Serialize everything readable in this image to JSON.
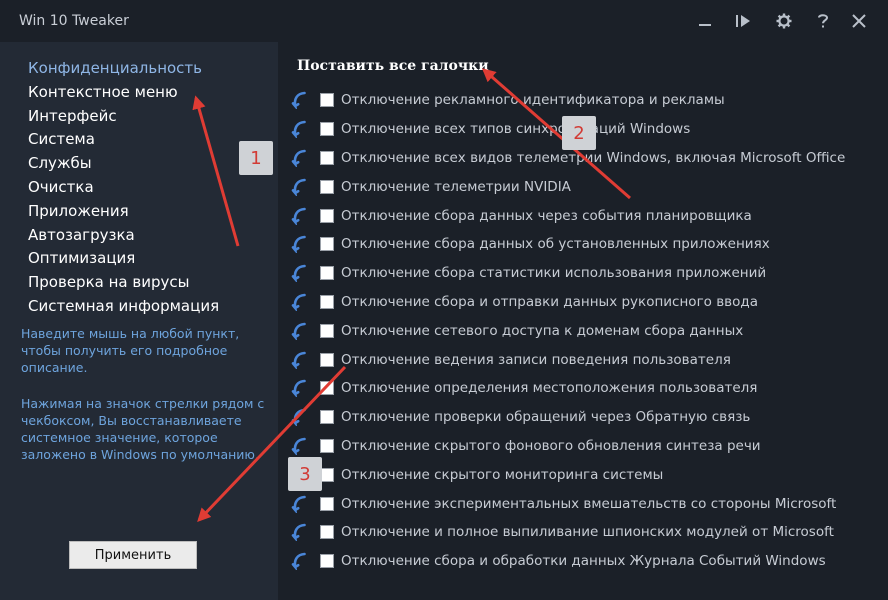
{
  "window": {
    "title": "Win 10 Tweaker"
  },
  "titlebar_controls": [
    {
      "name": "minimize-button",
      "icon": "minimize-icon"
    },
    {
      "name": "play-button",
      "icon": "play-icon"
    },
    {
      "name": "settings-button",
      "icon": "gear-icon"
    },
    {
      "name": "help-button",
      "icon": "question-icon"
    },
    {
      "name": "close-button",
      "icon": "close-icon"
    }
  ],
  "sidebar": {
    "items": [
      {
        "label": "Конфиденциальность",
        "active": true
      },
      {
        "label": "Контекстное меню",
        "active": false
      },
      {
        "label": "Интерфейс",
        "active": false
      },
      {
        "label": "Система",
        "active": false
      },
      {
        "label": "Службы",
        "active": false
      },
      {
        "label": "Очистка",
        "active": false
      },
      {
        "label": "Приложения",
        "active": false
      },
      {
        "label": "Автозагрузка",
        "active": false
      },
      {
        "label": "Оптимизация",
        "active": false
      },
      {
        "label": "Проверка на вирусы",
        "active": false
      },
      {
        "label": "Системная информация",
        "active": false
      }
    ],
    "hint1": "Наведите мышь на любой пункт, чтобы получить его подробное описание.",
    "hint2": "Нажимая на значок стрелки рядом с чекбоксом, Вы восстанавливаете системное значение, которое заложено в Windows по умолчанию.",
    "apply_label": "Применить"
  },
  "main": {
    "check_all_label": "Поставить все галочки",
    "options": [
      {
        "label": "Отключение рекламного идентификатора и рекламы",
        "checked": false
      },
      {
        "label": "Отключение всех типов синхронизаций Windows",
        "checked": false
      },
      {
        "label": "Отключение всех видов телеметрии Windows, включая Microsoft Office",
        "checked": false
      },
      {
        "label": "Отключение телеметрии NVIDIA",
        "checked": false
      },
      {
        "label": "Отключение сбора данных через события планировщика",
        "checked": false
      },
      {
        "label": "Отключение сбора данных об установленных приложениях",
        "checked": false
      },
      {
        "label": "Отключение сбора статистики использования приложений",
        "checked": false
      },
      {
        "label": "Отключение сбора и отправки данных рукописного ввода",
        "checked": false
      },
      {
        "label": "Отключение сетевого доступа к доменам сбора данных",
        "checked": false
      },
      {
        "label": "Отключение ведения записи поведения пользователя",
        "checked": false
      },
      {
        "label": "Отключение определения местоположения пользователя",
        "checked": false
      },
      {
        "label": "Отключение проверки обращений через Обратную связь",
        "checked": false
      },
      {
        "label": "Отключение скрытого фонового обновления синтеза речи",
        "checked": false
      },
      {
        "label": "Отключение скрытого мониторинга системы",
        "checked": false
      },
      {
        "label": "Отключение экспериментальных вмешательств со стороны Microsoft",
        "checked": false
      },
      {
        "label": "Отключение и полное выпиливание шпионских модулей от Microsoft",
        "checked": false
      },
      {
        "label": "Отключение сбора и обработки данных Журнала Событий Windows",
        "checked": false
      }
    ],
    "restore_icon": "restore-arrow-icon"
  },
  "annotations": {
    "badges": [
      "1",
      "2",
      "3"
    ],
    "color": "#e03c34"
  },
  "colors": {
    "background": "#1b2028",
    "sidebar": "#232a35",
    "active_item": "#8fb6e6",
    "hint_text": "#6ea4dd",
    "restore_icon": "#4a86d8"
  }
}
